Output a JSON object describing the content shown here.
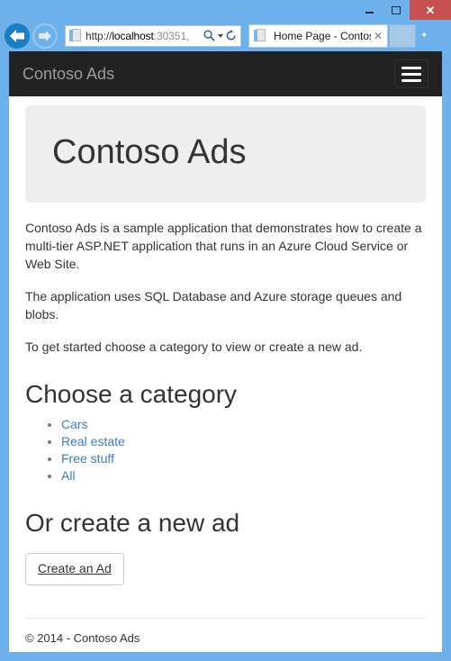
{
  "browser": {
    "window_controls": {
      "minimize_label": "—",
      "maximize_label": "□",
      "close_label": "✕"
    },
    "back_title": "Back",
    "forward_title": "Forward",
    "address": {
      "scheme_path": "http://",
      "host": "localhost",
      "rest": ":30351,",
      "full": "http://localhost:30351,",
      "search_icon": "magnifier-icon",
      "dropdown_icon": "chevron-down-icon",
      "refresh_icon": "refresh-icon"
    },
    "tab": {
      "title": "Home Page - Contoso...",
      "close_label": "✕"
    }
  },
  "site": {
    "navbar": {
      "brand": "Contoso Ads",
      "toggle_name": "hamburger-menu"
    },
    "jumbotron": {
      "title": "Contoso Ads"
    },
    "paragraphs": [
      "Contoso Ads is a sample application that demonstrates how to create a multi-tier ASP.NET application that runs in an Azure Cloud Service or Web Site.",
      "The application uses SQL Database and Azure storage queues and blobs.",
      "To get started choose a category to view or create a new ad."
    ],
    "category_section": {
      "heading": "Choose a category",
      "links": [
        {
          "label": "Cars"
        },
        {
          "label": "Real estate"
        },
        {
          "label": "Free stuff"
        },
        {
          "label": "All"
        }
      ]
    },
    "create_section": {
      "heading": "Or create a new ad",
      "button_label": "Create an Ad"
    },
    "footer": {
      "copyright": "© 2014 - Contoso Ads"
    }
  },
  "colors": {
    "window_frame": "#6cb0ec",
    "navbar_bg": "#222222",
    "brand_text": "#9d9d9d",
    "jumbotron_bg": "#eeeeee",
    "link_blue": "#3a7cc4",
    "close_button": "#c75050"
  }
}
